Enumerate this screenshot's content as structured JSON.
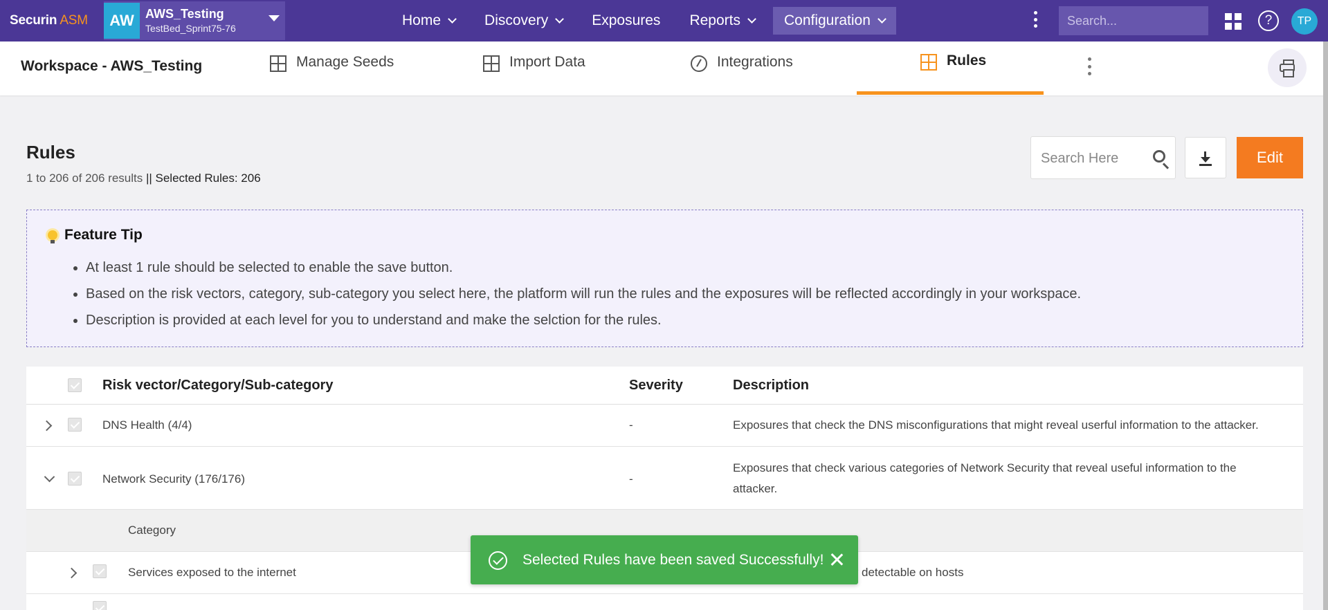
{
  "app": {
    "logo_main": "Securin",
    "logo_suffix": " ASM"
  },
  "workspace_switcher": {
    "avatar": "AW",
    "name": "AWS_Testing",
    "sub": "TestBed_Sprint75-76"
  },
  "nav": {
    "items": [
      {
        "label": "Home",
        "has_menu": true
      },
      {
        "label": "Discovery",
        "has_menu": true
      },
      {
        "label": "Exposures",
        "has_menu": false
      },
      {
        "label": "Reports",
        "has_menu": true
      },
      {
        "label": "Configuration",
        "has_menu": true,
        "active": true
      }
    ]
  },
  "topbar": {
    "search_placeholder": "Search...",
    "help": "?",
    "user_initials": "TP"
  },
  "subheader": {
    "title": "Workspace - AWS_Testing",
    "tabs": [
      {
        "label": "Manage Seeds"
      },
      {
        "label": "Import Data"
      },
      {
        "label": "Integrations"
      },
      {
        "label": "Rules",
        "active": true
      }
    ]
  },
  "page": {
    "title": "Rules",
    "results": "1 to 206 of 206 results",
    "selected": " || Selected Rules: 206",
    "search_placeholder": "Search Here",
    "edit_label": "Edit"
  },
  "feature_tip": {
    "heading": "Feature Tip",
    "items": [
      "At least 1 rule should be selected to enable the save button.",
      "Based on the risk vectors, category, sub-category you select here, the platform will run the rules and the exposures will be reflected accordingly in your workspace.",
      "Description is provided at each level for you to understand and make the selction for the rules."
    ]
  },
  "table": {
    "headers": {
      "name": "Risk vector/Category/Sub-category",
      "severity": "Severity",
      "description": "Description"
    },
    "rows": [
      {
        "name": "DNS Health (4/4)",
        "severity": "-",
        "description": "Exposures that check the DNS misconfigurations that might reveal userful information to the attacker."
      },
      {
        "name": "Network Security (176/176)",
        "severity": "-",
        "description": "Exposures that check various categories of Network Security that reveal useful information to the attacker."
      }
    ],
    "category_label": "Category",
    "sub_rows": [
      {
        "name": "Services exposed to the internet",
        "description_visible": "ly detectable on hosts"
      }
    ]
  },
  "toast": {
    "message": "Selected Rules have been saved Successfully!"
  },
  "colors": {
    "brand": "#4b3796",
    "accent": "#f47b20",
    "success": "#46ad4f",
    "info": "#29a9d6"
  }
}
